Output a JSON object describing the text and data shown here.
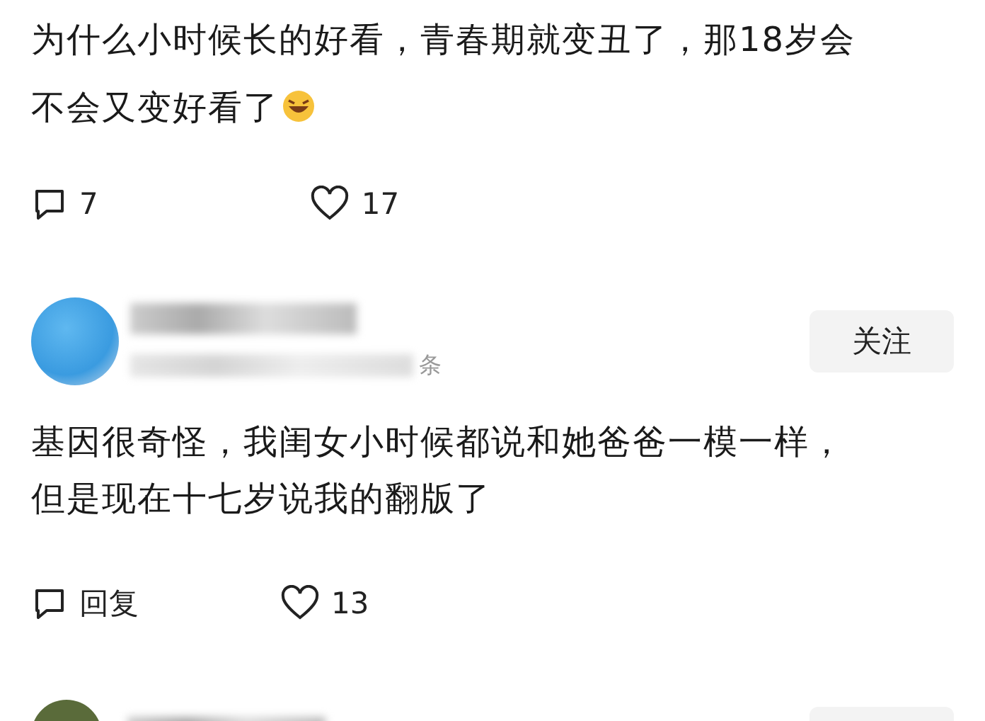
{
  "post": {
    "text": "为什么小时候长的好看，青春期就变丑了，那18岁会不会又变好看了",
    "comment_count": "7",
    "like_count": "17"
  },
  "comment": {
    "meta_suffix": "条",
    "follow_label": "关注",
    "text": "基因很奇怪，我闺女小时候都说和她爸爸一模一样，但是现在十七岁说我的翻版了",
    "reply_label": "回复",
    "like_count": "13"
  }
}
